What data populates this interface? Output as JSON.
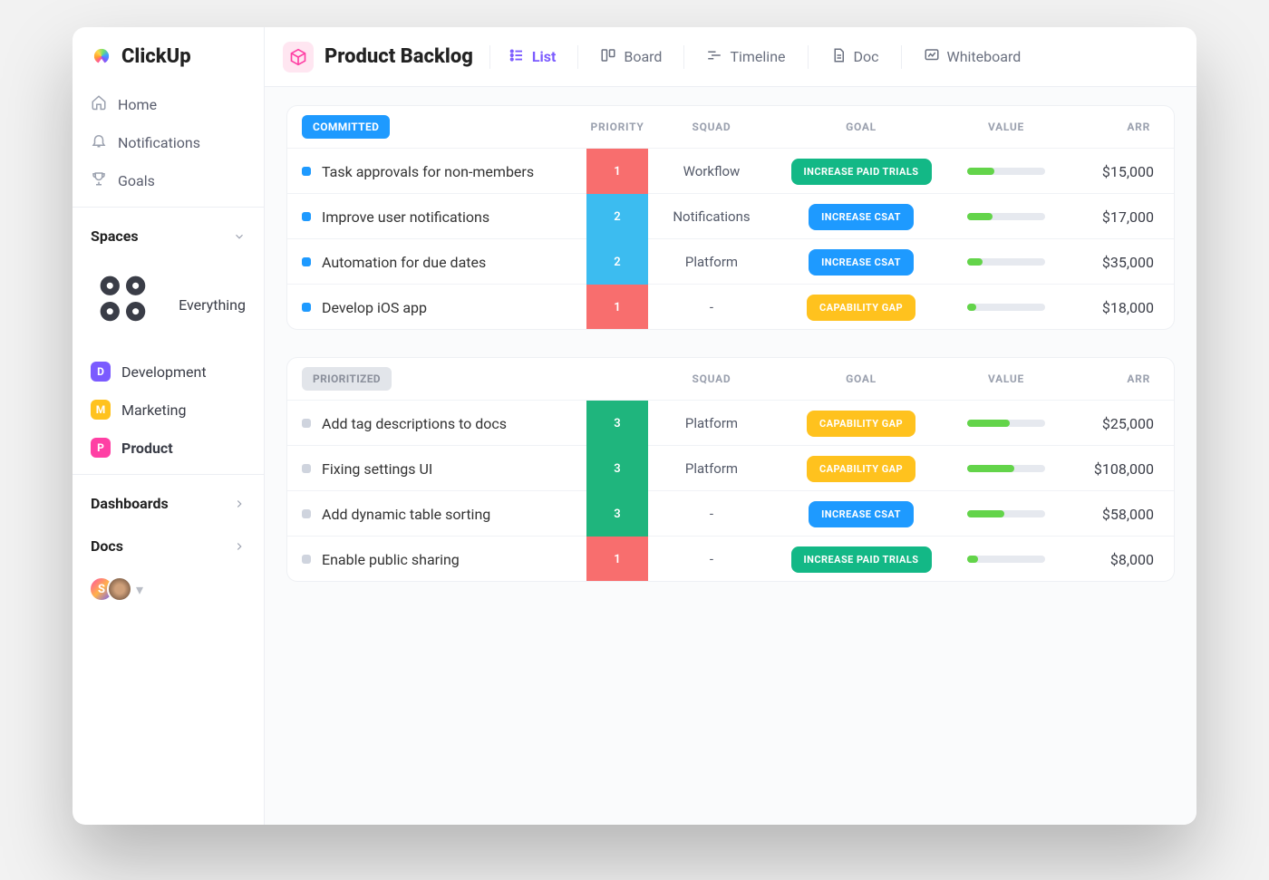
{
  "brand": "ClickUp",
  "sidebar": {
    "nav": [
      {
        "label": "Home",
        "icon": "home"
      },
      {
        "label": "Notifications",
        "icon": "bell"
      },
      {
        "label": "Goals",
        "icon": "trophy"
      }
    ],
    "spaces_header": "Spaces",
    "everything_label": "Everything",
    "spaces": [
      {
        "letter": "D",
        "label": "Development",
        "color": "#7b5bff",
        "active": false
      },
      {
        "letter": "M",
        "label": "Marketing",
        "color": "#ffc21e",
        "active": false
      },
      {
        "letter": "P",
        "label": "Product",
        "color": "#ff3fa4",
        "active": true
      }
    ],
    "dashboards_label": "Dashboards",
    "docs_label": "Docs",
    "avatar_letter": "S"
  },
  "header": {
    "title": "Product Backlog",
    "views": [
      {
        "label": "List",
        "icon": "list",
        "active": true
      },
      {
        "label": "Board",
        "icon": "board",
        "active": false
      },
      {
        "label": "Timeline",
        "icon": "timeline",
        "active": false
      },
      {
        "label": "Doc",
        "icon": "doc",
        "active": false
      },
      {
        "label": "Whiteboard",
        "icon": "whiteboard",
        "active": false
      }
    ]
  },
  "columns": {
    "priority": "PRIORITY",
    "squad": "SQUAD",
    "goal": "GOAL",
    "value": "VALUE",
    "arr": "ARR"
  },
  "groups": [
    {
      "status_label": "COMMITTED",
      "status_color": "#1e9aff",
      "marker_blue": true,
      "show_priority_header": true,
      "tasks": [
        {
          "name": "Task approvals for non-members",
          "priority": "1",
          "priority_color": "#f86e6e",
          "squad": "Workflow",
          "goal": "INCREASE PAID TRIALS",
          "goal_color": "#13b886",
          "value_pct": 35,
          "arr": "$15,000"
        },
        {
          "name": "Improve  user notifications",
          "priority": "2",
          "priority_color": "#3cbcf0",
          "squad": "Notifications",
          "goal": "INCREASE CSAT",
          "goal_color": "#1e9aff",
          "value_pct": 32,
          "arr": "$17,000"
        },
        {
          "name": "Automation for due dates",
          "priority": "2",
          "priority_color": "#3cbcf0",
          "squad": "Platform",
          "goal": "INCREASE CSAT",
          "goal_color": "#1e9aff",
          "value_pct": 20,
          "arr": "$35,000"
        },
        {
          "name": "Develop iOS app",
          "priority": "1",
          "priority_color": "#f86e6e",
          "squad": "-",
          "goal": "CAPABILITY GAP",
          "goal_color": "#ffc21e",
          "value_pct": 12,
          "arr": "$18,000"
        }
      ]
    },
    {
      "status_label": "PRIORITIZED",
      "status_color": "#e2e5ea",
      "status_text_color": "#8a8f9b",
      "marker_blue": false,
      "show_priority_header": false,
      "tasks": [
        {
          "name": "Add tag descriptions to docs",
          "priority": "3",
          "priority_color": "#1fb57d",
          "squad": "Platform",
          "goal": "CAPABILITY GAP",
          "goal_color": "#ffc21e",
          "value_pct": 55,
          "arr": "$25,000"
        },
        {
          "name": "Fixing settings UI",
          "priority": "3",
          "priority_color": "#1fb57d",
          "squad": "Platform",
          "goal": "CAPABILITY GAP",
          "goal_color": "#ffc21e",
          "value_pct": 60,
          "arr": "$108,000"
        },
        {
          "name": "Add dynamic table sorting",
          "priority": "3",
          "priority_color": "#1fb57d",
          "squad": "-",
          "goal": "INCREASE CSAT",
          "goal_color": "#1e9aff",
          "value_pct": 48,
          "arr": "$58,000"
        },
        {
          "name": "Enable public sharing",
          "priority": "1",
          "priority_color": "#f86e6e",
          "squad": "-",
          "goal": "INCREASE PAID TRIALS",
          "goal_color": "#13b886",
          "value_pct": 14,
          "arr": "$8,000"
        }
      ]
    }
  ]
}
